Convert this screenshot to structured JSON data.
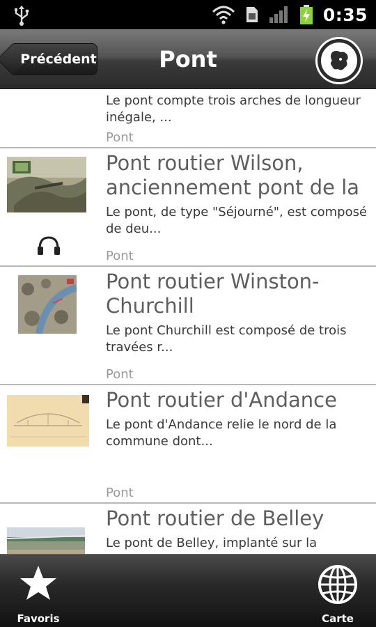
{
  "status_bar": {
    "time": "0:35",
    "icons": [
      "usb-icon",
      "wifi-icon",
      "sim-icon",
      "signal-icon",
      "battery-charging-icon"
    ]
  },
  "action_bar": {
    "back_label": "Précédent",
    "title": "Pont",
    "logo_icon": "app-logo-icon"
  },
  "list": {
    "items": [
      {
        "title": "",
        "description": "Le pont compte trois arches de longueur inégale, ...",
        "category": "Pont",
        "has_audio": false
      },
      {
        "title": "Pont routier Wilson, anciennement pont de la",
        "description": "Le pont, de type \"Séjourné\", est composé de deu...",
        "category": "Pont",
        "has_audio": true
      },
      {
        "title": "Pont routier Winston-Churchill",
        "description": "Le pont Churchill est composé de trois travées r...",
        "category": "Pont",
        "has_audio": false
      },
      {
        "title": "Pont routier d'Andance",
        "description": "Le pont d'Andance relie le nord de la commune dont...",
        "category": "Pont",
        "has_audio": false
      },
      {
        "title": "Pont routier de Belley",
        "description": "Le pont de Belley, implanté sur la",
        "category": "",
        "has_audio": false
      }
    ]
  },
  "bottom_bar": {
    "favorites_label": "Favoris",
    "favorites_icon": "star-icon",
    "map_label": "Carte",
    "map_icon": "globe-icon"
  },
  "colors": {
    "title_text": "#5e5e5e",
    "category_text": "#9a9a9a",
    "divider": "#b8b8b8",
    "battery": "#8cd23a"
  }
}
